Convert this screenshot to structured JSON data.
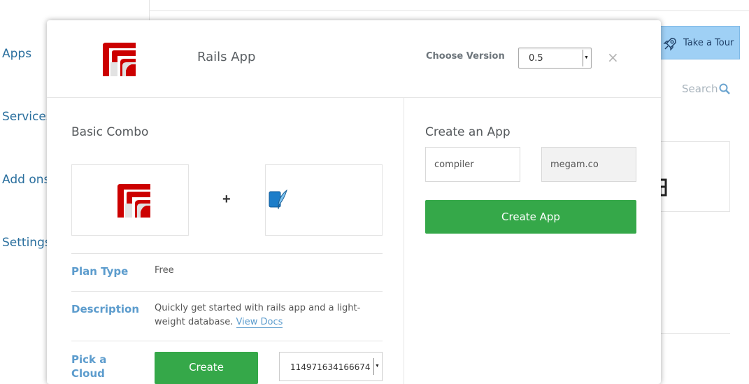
{
  "sidebar": {
    "items": [
      {
        "label": "Apps"
      },
      {
        "label": "Services"
      },
      {
        "label": "Add ons"
      },
      {
        "label": "Settings"
      }
    ]
  },
  "topbar": {
    "tour_label": "Take a Tour",
    "search_label": "Search"
  },
  "modal": {
    "title": "Rails App",
    "version_label": "Choose Version",
    "version_value": "0.5",
    "close_symbol": "×",
    "combo": {
      "title": "Basic Combo",
      "plus_symbol": "+"
    },
    "plan": {
      "label": "Plan Type",
      "value": "Free"
    },
    "description": {
      "label": "Description",
      "text": "Quickly get started with rails app and a light-weight database.",
      "link_label": "View Docs"
    },
    "cloud": {
      "label": "Pick a Cloud",
      "create_label": "Create",
      "select_value": "114971634166674"
    },
    "create_app": {
      "title": "Create an App",
      "name_value": "compiler",
      "domain_value": "megam.co",
      "button_label": "Create App"
    }
  },
  "colors": {
    "accent_green": "#35a849",
    "link_blue": "#5c9ccd",
    "rails_red": "#cc0000",
    "tour_blue": "#9fd0f5"
  }
}
